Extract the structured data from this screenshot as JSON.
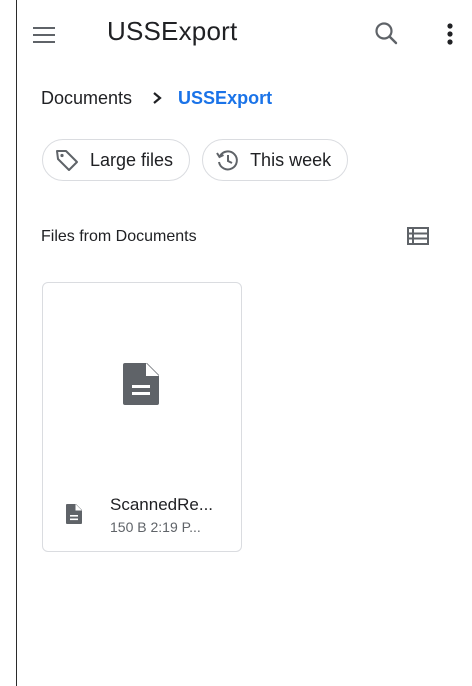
{
  "app_bar": {
    "title": "USSExport",
    "menu_icon": "hamburger-menu-icon",
    "search_icon": "search-icon",
    "more_icon": "more-vert-icon"
  },
  "breadcrumb": {
    "root": "Documents",
    "separator_icon": "chevron-right-icon",
    "current": "USSExport"
  },
  "filters": [
    {
      "label": "Large files",
      "icon": "tag-icon"
    },
    {
      "label": "This week",
      "icon": "history-icon"
    }
  ],
  "section": {
    "label": "Files from Documents",
    "view_toggle_icon": "list-view-icon"
  },
  "files": [
    {
      "name": "ScannedRe...",
      "info": "150 B 2:19 P...",
      "icon": "document-icon"
    }
  ],
  "colors": {
    "accent": "#1a73e8",
    "text": "#202124",
    "secondary_text": "#5f6368",
    "icon": "#5f6368",
    "border": "#dadce0"
  }
}
